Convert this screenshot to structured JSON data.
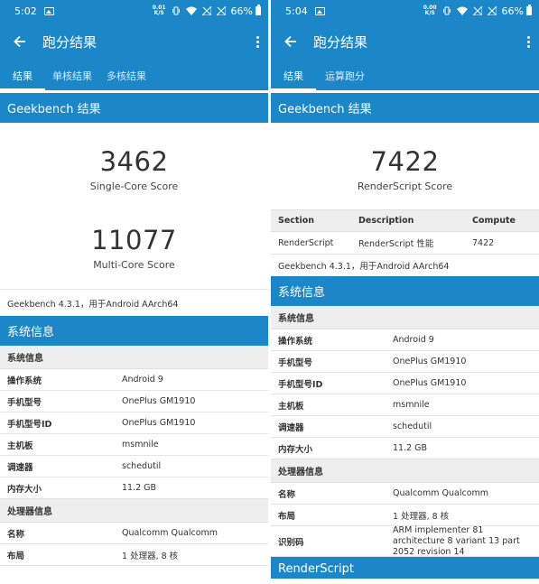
{
  "left": {
    "status": {
      "time": "5:02",
      "net_top": "0.01",
      "net_bottom": "K/S",
      "battery": "66%"
    },
    "appbar": {
      "title": "跑分结果"
    },
    "tabs": [
      {
        "label": "结果",
        "active": true
      },
      {
        "label": "单核结果",
        "active": false
      },
      {
        "label": "多核结果",
        "active": false
      }
    ],
    "header": "Geekbench 结果",
    "scores": [
      {
        "value": "3462",
        "label": "Single-Core Score"
      },
      {
        "value": "11077",
        "label": "Multi-Core Score"
      }
    ],
    "version_line": "Geekbench 4.3.1，用于Android AArch64",
    "system_header": "系统信息",
    "system_sub": "系统信息",
    "system_rows": [
      {
        "k": "操作系统",
        "v": "Android 9"
      },
      {
        "k": "手机型号",
        "v": "OnePlus GM1910"
      },
      {
        "k": "手机型号ID",
        "v": "OnePlus GM1910"
      },
      {
        "k": "主机板",
        "v": "msmnile"
      },
      {
        "k": "调速器",
        "v": "schedutil"
      },
      {
        "k": "内存大小",
        "v": "11.2 GB"
      }
    ],
    "cpu_sub": "处理器信息",
    "cpu_rows": [
      {
        "k": "名称",
        "v": "Qualcomm Qualcomm"
      },
      {
        "k": "布局",
        "v": "1 处理器, 8 核"
      }
    ]
  },
  "right": {
    "status": {
      "time": "5:04",
      "net_top": "0.00",
      "net_bottom": "K/S",
      "battery": "66%"
    },
    "appbar": {
      "title": "跑分结果"
    },
    "tabs": [
      {
        "label": "结果",
        "active": true
      },
      {
        "label": "运算跑分",
        "active": false
      }
    ],
    "header": "Geekbench 结果",
    "score": {
      "value": "7422",
      "label": "RenderScript Score"
    },
    "table": {
      "headers": [
        "Section",
        "Description",
        "Compute"
      ],
      "row": [
        "RenderScript",
        "RenderScript 性能",
        "7422"
      ]
    },
    "version_line": "Geekbench 4.3.1，用于Android AArch64",
    "system_header": "系统信息",
    "system_sub": "系统信息",
    "system_rows": [
      {
        "k": "操作系统",
        "v": "Android 9"
      },
      {
        "k": "手机型号",
        "v": "OnePlus GM1910"
      },
      {
        "k": "手机型号ID",
        "v": "OnePlus GM1910"
      },
      {
        "k": "主机板",
        "v": "msmnile"
      },
      {
        "k": "调速器",
        "v": "schedutil"
      },
      {
        "k": "内存大小",
        "v": "11.2 GB"
      }
    ],
    "cpu_sub": "处理器信息",
    "cpu_rows": [
      {
        "k": "名称",
        "v": "Qualcomm Qualcomm"
      },
      {
        "k": "布局",
        "v": "1 处理器, 8 核"
      },
      {
        "k": "识别码",
        "v": "ARM implementer 81 architecture 8 variant 13 part 2052 revision 14"
      }
    ],
    "footer_header": "RenderScript"
  },
  "colors": {
    "accent": "#1b87c9",
    "subhead_bg": "#eeeeee"
  }
}
